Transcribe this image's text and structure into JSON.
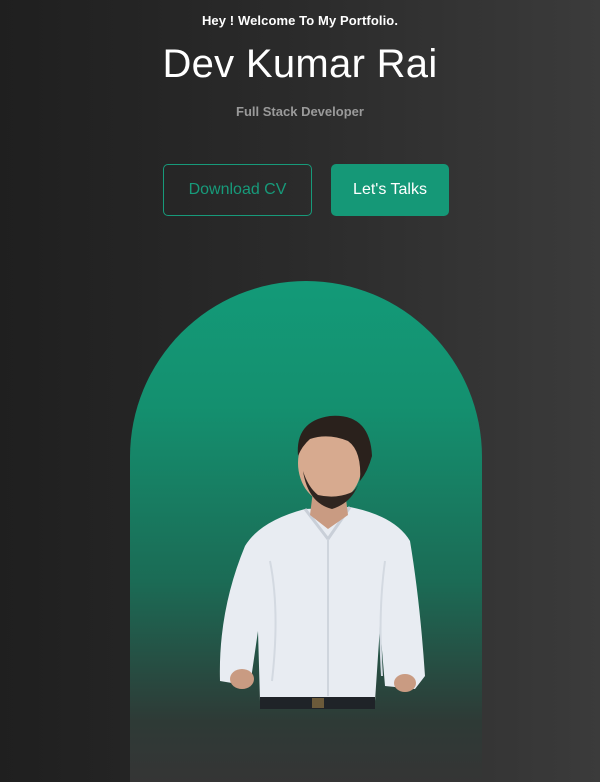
{
  "hero": {
    "greeting": "Hey ! Welcome To My Portfolio.",
    "name": "Dev Kumar Rai",
    "role": "Full Stack Developer"
  },
  "actions": {
    "download_cv_label": "Download CV",
    "lets_talk_label": "Let's Talks"
  },
  "portrait": {
    "alt": "Portrait of Dev Kumar Rai"
  },
  "colors": {
    "accent": "#159877",
    "background_dark": "#1f1f1f",
    "background_light": "#3b3b3b",
    "muted_text": "#9a9a9a"
  }
}
